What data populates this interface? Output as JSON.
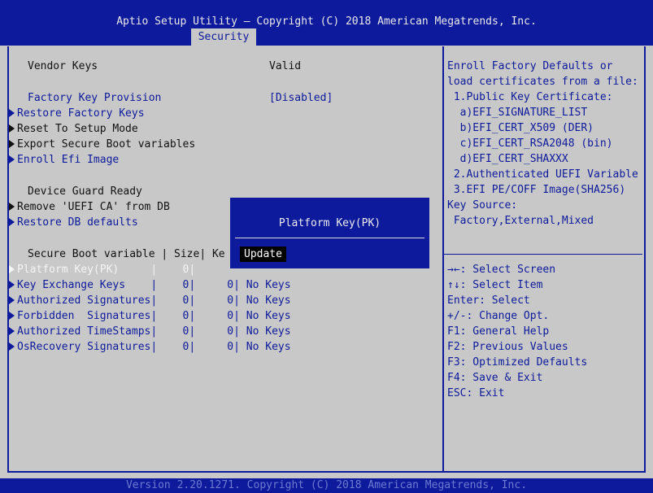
{
  "header": {
    "title": "Aptio Setup Utility – Copyright (C) 2018 American Megatrends, Inc.",
    "tab": "Security"
  },
  "footer": "Version 2.20.1271. Copyright (C) 2018 American Megatrends, Inc.",
  "colors": {
    "bios_blue": "#0d1a9b",
    "background": "#c8c8c8"
  },
  "main": {
    "vendor_keys_label": "Vendor Keys",
    "vendor_keys_value": "Valid",
    "factory_key_label": "Factory Key Provision",
    "factory_key_value": "[Disabled]",
    "restore_factory_keys": "Restore Factory Keys",
    "reset_setup_mode": "Reset To Setup Mode",
    "export_secure_boot": "Export Secure Boot variables",
    "enroll_efi_image": "Enroll Efi Image",
    "device_guard_ready": "Device Guard Ready",
    "remove_uefi_ca": "Remove 'UEFI CA' from DB",
    "restore_db_defaults": "Restore DB defaults",
    "table_header": "Secure Boot variable | Size| Ke",
    "rows": [
      {
        "text": "Platform Key(PK)     |    0|"
      },
      {
        "text": "Key Exchange Keys    |    0|     0| No Keys"
      },
      {
        "text": "Authorized Signatures|    0|     0| No Keys"
      },
      {
        "text": "Forbidden  Signatures|    0|     0| No Keys"
      },
      {
        "text": "Authorized TimeStamps|    0|     0| No Keys"
      },
      {
        "text": "OsRecovery Signatures|    0|     0| No Keys"
      }
    ]
  },
  "help": {
    "lines": [
      "Enroll Factory Defaults or",
      "load certificates from a file:",
      " 1.Public Key Certificate:",
      "  a)EFI_SIGNATURE_LIST",
      "  b)EFI_CERT_X509 (DER)",
      "  c)EFI_CERT_RSA2048 (bin)",
      "  d)EFI_CERT_SHAXXX",
      " 2.Authenticated UEFI Variable",
      " 3.EFI PE/COFF Image(SHA256)",
      "Key Source:",
      " Factory,External,Mixed"
    ],
    "keys": [
      "→←: Select Screen",
      "↑↓: Select Item",
      "Enter: Select",
      "+/-: Change Opt.",
      "F1: General Help",
      "F2: Previous Values",
      "F3: Optimized Defaults",
      "F4: Save & Exit",
      "ESC: Exit"
    ]
  },
  "dialog": {
    "title": "Platform Key(PK)",
    "option": "Update"
  }
}
